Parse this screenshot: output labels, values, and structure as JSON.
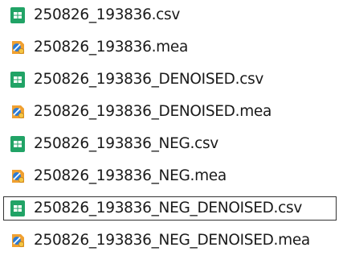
{
  "files": [
    {
      "name": "250826_193836.csv",
      "icon": "csv-file-icon",
      "selected": false
    },
    {
      "name": "250826_193836.mea",
      "icon": "mea-file-icon",
      "selected": false
    },
    {
      "name": "250826_193836_DENOISED.csv",
      "icon": "csv-file-icon",
      "selected": false
    },
    {
      "name": "250826_193836_DENOISED.mea",
      "icon": "mea-file-icon",
      "selected": false
    },
    {
      "name": "250826_193836_NEG.csv",
      "icon": "csv-file-icon",
      "selected": false
    },
    {
      "name": "250826_193836_NEG.mea",
      "icon": "mea-file-icon",
      "selected": false
    },
    {
      "name": "250826_193836_NEG_DENOISED.csv",
      "icon": "csv-file-icon",
      "selected": true
    },
    {
      "name": "250826_193836_NEG_DENOISED.mea",
      "icon": "mea-file-icon",
      "selected": false
    }
  ],
  "colors": {
    "csv_icon": "#21a366",
    "mea_icon_orange": "#f0a030",
    "mea_icon_blue": "#2b7bd6",
    "focus_border": "#333333"
  }
}
